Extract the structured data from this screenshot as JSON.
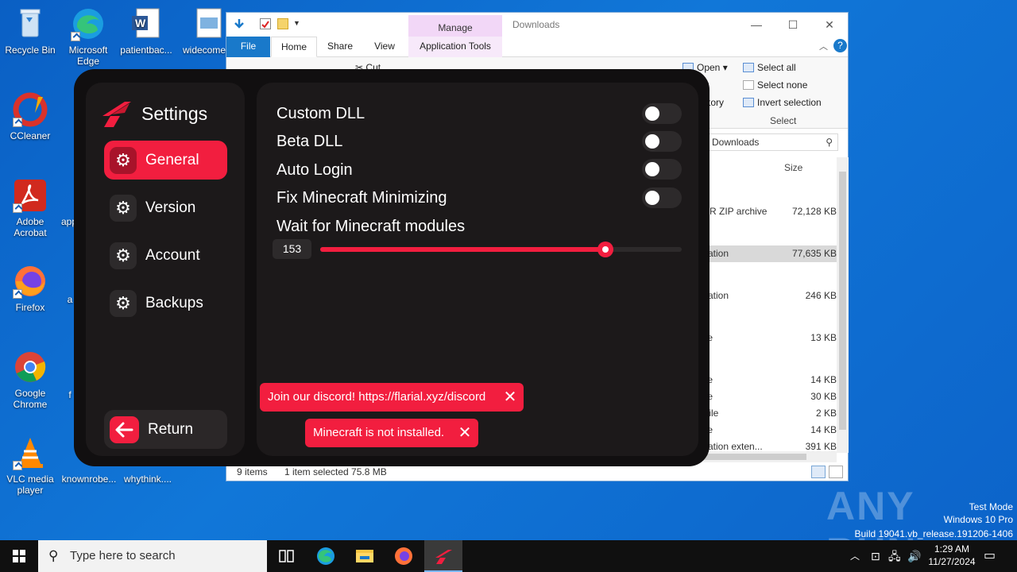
{
  "desktop": {
    "icons": [
      {
        "label": "Recycle Bin"
      },
      {
        "label": "Microsoft Edge"
      },
      {
        "label": "patientbac..."
      },
      {
        "label": "widecome..."
      },
      {
        "label": "CCleaner"
      },
      {
        "label": "Adobe Acrobat"
      },
      {
        "label": "app"
      },
      {
        "label": "Firefox"
      },
      {
        "label": "a"
      },
      {
        "label": "Google Chrome"
      },
      {
        "label": "f"
      },
      {
        "label": "VLC media player"
      },
      {
        "label": "knownrobe..."
      },
      {
        "label": "whythink...."
      }
    ]
  },
  "explorer": {
    "title": "Downloads",
    "manage_tab": "Manage",
    "tabs": {
      "file": "File",
      "home": "Home",
      "share": "Share",
      "view": "View",
      "app_tools": "Application Tools"
    },
    "ribbon": {
      "cut": "Cut",
      "open": "Open",
      "history_partial": "tory",
      "t_partial": "t",
      "select_all": "Select all",
      "select_none": "Select none",
      "invert_selection": "Invert selection",
      "select_group": "Select"
    },
    "search_placeholder": "n Downloads",
    "column_size": "Size",
    "files": [
      {
        "type": "AR ZIP archive",
        "size": "72,128 KB"
      },
      {
        "type": "cation",
        "size": "77,635 KB"
      },
      {
        "type": "cation",
        "size": "246 KB"
      },
      {
        "type": "ile",
        "size": "13 KB"
      },
      {
        "type": "ile",
        "size": "14 KB"
      },
      {
        "type": "ile",
        "size": "30 KB"
      },
      {
        "type": "File",
        "size": "2 KB"
      },
      {
        "type": "ile",
        "size": "14 KB"
      },
      {
        "type": "cation exten...",
        "size": "391 KB"
      }
    ],
    "status": {
      "items": "9 items",
      "selected": "1 item selected  75.8 MB"
    }
  },
  "launcher": {
    "title": "Settings",
    "nav": [
      {
        "label": "General",
        "active": true
      },
      {
        "label": "Version",
        "active": false
      },
      {
        "label": "Account",
        "active": false
      },
      {
        "label": "Backups",
        "active": false
      }
    ],
    "return_label": "Return",
    "options": [
      {
        "label": "Custom DLL",
        "enabled": false
      },
      {
        "label": "Beta DLL",
        "enabled": false
      },
      {
        "label": "Auto Login",
        "enabled": false
      },
      {
        "label": "Fix Minecraft Minimizing",
        "enabled": false
      }
    ],
    "slider": {
      "label": "Wait for Minecraft modules",
      "value": "153",
      "fraction": 0.79
    },
    "toasts": [
      {
        "text": "Join our discord! https://flarial.xyz/discord"
      },
      {
        "text": "Minecraft is not installed."
      }
    ],
    "accent": "#f21e3f"
  },
  "watermark": {
    "brand": "ANY RUN",
    "line1": "Test Mode",
    "line2": "Windows 10 Pro",
    "line3": "Build 19041.vb_release.191206-1406"
  },
  "taskbar": {
    "search_placeholder": "Type here to search",
    "time": "1:29 AM",
    "date": "11/27/2024"
  }
}
